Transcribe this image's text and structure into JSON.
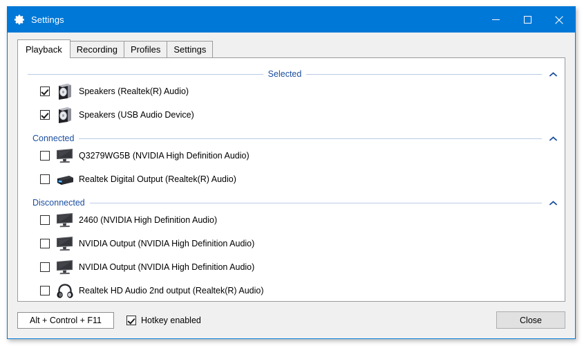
{
  "window": {
    "title": "Settings",
    "icon": "gear-icon",
    "accent_color": "#0078d7",
    "caption_buttons": [
      {
        "name": "minimize",
        "glyph": "minimize-icon"
      },
      {
        "name": "maximize",
        "glyph": "maximize-icon"
      },
      {
        "name": "close",
        "glyph": "close-icon"
      }
    ]
  },
  "tabs": [
    {
      "label": "Playback",
      "active": true
    },
    {
      "label": "Recording",
      "active": false
    },
    {
      "label": "Profiles",
      "active": false
    },
    {
      "label": "Settings",
      "active": false
    }
  ],
  "groups": [
    {
      "label": "Selected",
      "align": "center",
      "expanded": true,
      "chevron": "chevron-up-icon",
      "devices": [
        {
          "label": "Speakers (Realtek(R) Audio)",
          "checked": true,
          "icon": "speaker-icon"
        },
        {
          "label": "Speakers (USB Audio Device)",
          "checked": true,
          "icon": "speaker-icon"
        }
      ]
    },
    {
      "label": "Connected",
      "align": "left",
      "expanded": true,
      "chevron": "chevron-up-icon",
      "devices": [
        {
          "label": "Q3279WG5B (NVIDIA High Definition Audio)",
          "checked": false,
          "icon": "monitor-icon"
        },
        {
          "label": "Realtek Digital Output (Realtek(R) Audio)",
          "checked": false,
          "icon": "spdif-icon"
        }
      ]
    },
    {
      "label": "Disconnected",
      "align": "left",
      "expanded": true,
      "chevron": "chevron-up-icon",
      "devices": [
        {
          "label": "2460 (NVIDIA High Definition Audio)",
          "checked": false,
          "icon": "monitor-icon"
        },
        {
          "label": "NVIDIA Output (NVIDIA High Definition Audio)",
          "checked": false,
          "icon": "monitor-icon"
        },
        {
          "label": "NVIDIA Output (NVIDIA High Definition Audio)",
          "checked": false,
          "icon": "monitor-icon"
        },
        {
          "label": "Realtek HD Audio 2nd output (Realtek(R) Audio)",
          "checked": false,
          "icon": "headphones-icon"
        }
      ]
    }
  ],
  "footer": {
    "hotkey_value": "Alt + Control + F11",
    "hotkey_enabled_label": "Hotkey enabled",
    "hotkey_enabled": true,
    "close_label": "Close"
  }
}
